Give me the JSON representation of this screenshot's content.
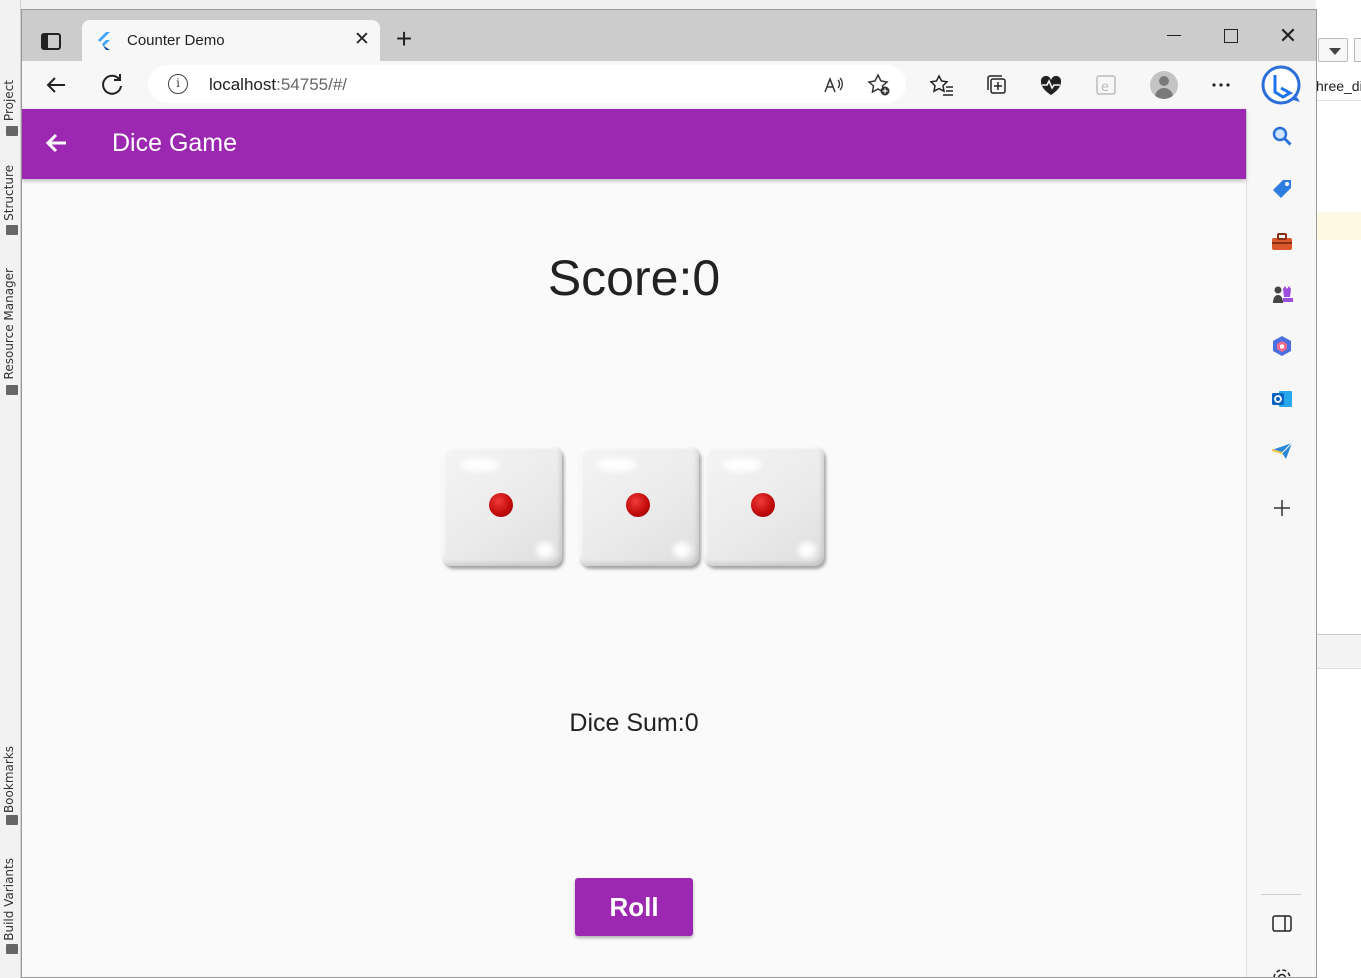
{
  "ide": {
    "left_tabs": [
      "Project",
      "Structure",
      "Resource Manager",
      "Bookmarks",
      "Build Variants"
    ],
    "right_file_label": "hree_di"
  },
  "browser": {
    "tab_title": "Counter Demo",
    "tab_close": "✕",
    "new_tab": "+",
    "url_host": "localhost",
    "url_rest": ":54755/#/",
    "window_close": "✕"
  },
  "app": {
    "appbar_title": "Dice Game",
    "score_text": "Score:0",
    "dice": [
      {
        "value": 1
      },
      {
        "value": 1
      },
      {
        "value": 1
      }
    ],
    "dice_sum_text": "Dice Sum:0",
    "roll_label": "Roll",
    "colors": {
      "primary": "#9c27b0",
      "pip": "#c40c0c"
    }
  }
}
